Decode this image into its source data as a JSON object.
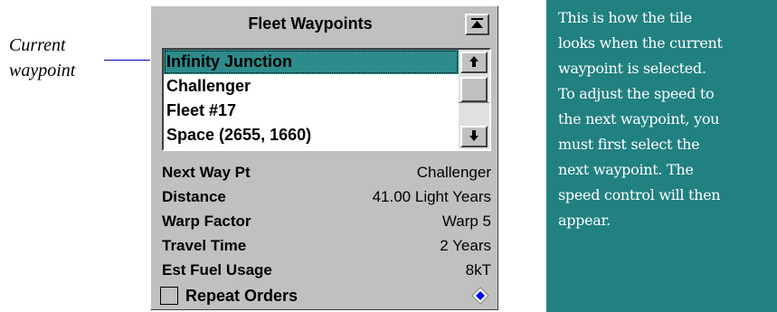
{
  "callout": {
    "line1": "Current",
    "line2": "waypoint"
  },
  "tile": {
    "title": "Fleet Waypoints",
    "collapse_icon": "collapse-up-icon",
    "waypoints": [
      "Infinity Junction",
      "Challenger",
      "Fleet #17",
      "Space (2655, 1660)"
    ],
    "selected_index": 0,
    "stats": [
      {
        "label": "Next Way Pt",
        "value": "Challenger"
      },
      {
        "label": "Distance",
        "value": "41.00 Light Years"
      },
      {
        "label": "Warp Factor",
        "value": "Warp 5"
      },
      {
        "label": "Travel Time",
        "value": "2 Years"
      },
      {
        "label": "Est Fuel Usage",
        "value": "8kT"
      }
    ],
    "repeat_orders_label": "Repeat Orders",
    "repeat_orders_checked": false
  },
  "info": {
    "lines": [
      "This is how the tile",
      "looks when the current",
      "waypoint is selected.",
      "To adjust the speed to",
      "the next waypoint, you",
      "must first select the",
      "next waypoint. The",
      "speed control will then",
      "appear."
    ]
  },
  "colors": {
    "selection": "#2d8b8b",
    "info_panel": "#218080",
    "tile_bg": "#c0c0c0"
  }
}
